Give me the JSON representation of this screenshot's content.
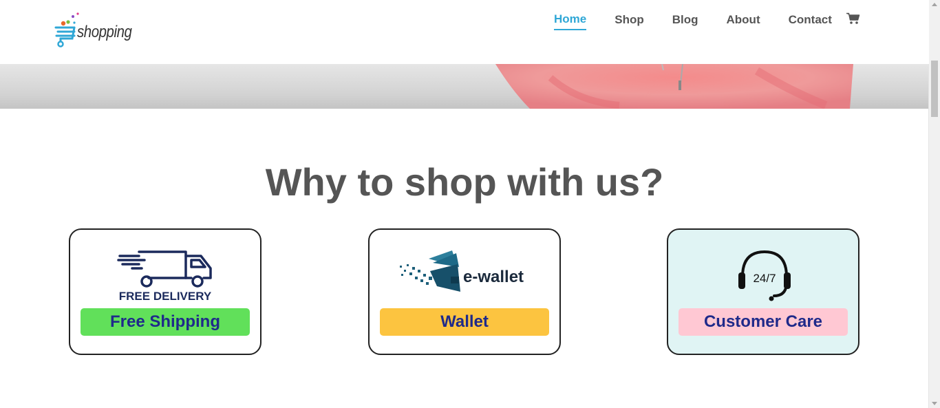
{
  "brand": {
    "logo_text": "shopping"
  },
  "nav": {
    "items": [
      {
        "label": "Home",
        "active": true
      },
      {
        "label": "Shop",
        "active": false
      },
      {
        "label": "Blog",
        "active": false
      },
      {
        "label": "About",
        "active": false
      },
      {
        "label": "Contact",
        "active": false
      }
    ],
    "cart_icon": "shopping-cart-icon"
  },
  "section": {
    "title": "Why to shop with us?"
  },
  "features": [
    {
      "icon": "delivery-truck-icon",
      "icon_caption": "FREE DELIVERY",
      "button_label": "Free Shipping",
      "button_color": "#61e05a"
    },
    {
      "icon": "e-wallet-icon",
      "icon_caption": "e-wallet",
      "button_label": "Wallet",
      "button_color": "#fcc440"
    },
    {
      "icon": "headset-24-7-icon",
      "icon_caption": "24/7",
      "button_label": "Customer Care",
      "button_color": "#ffc8d3"
    }
  ],
  "colors": {
    "accent": "#2fa7d6",
    "nav_text": "#555555",
    "title_text": "#555555",
    "button_text": "#1f2a8a",
    "care_card_bg": "#e0f4f4"
  }
}
